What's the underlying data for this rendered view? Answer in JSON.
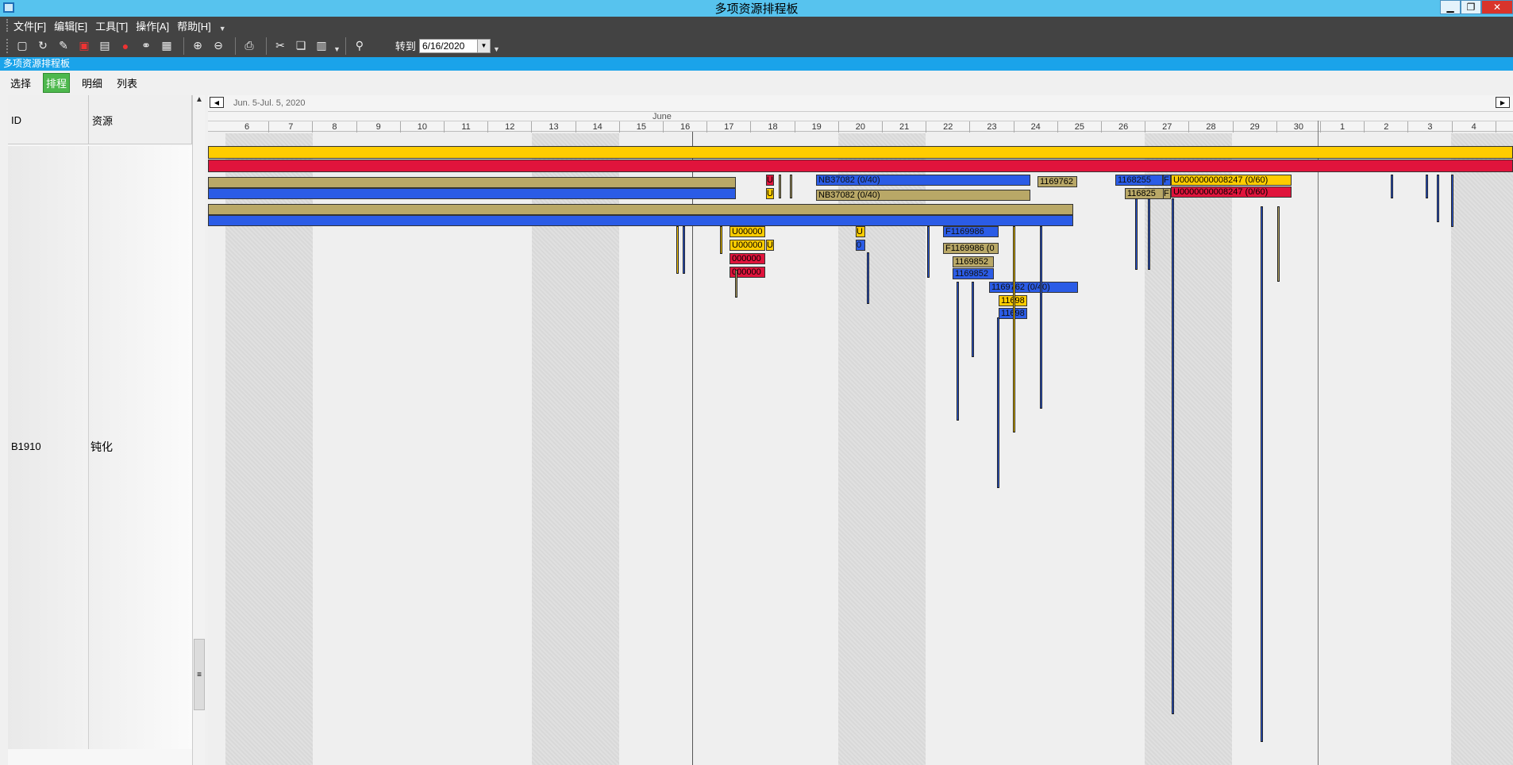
{
  "window": {
    "title": "多项资源排程板",
    "minimize": "▁",
    "restore": "❐",
    "close": "✕"
  },
  "menu": [
    "文件[F]",
    "编辑[E]",
    "工具[T]",
    "操作[A]",
    "帮助[H]"
  ],
  "toolbar": {
    "icons": [
      "new-icon",
      "refresh-icon",
      "clear-icon",
      "save-icon",
      "clipboard-icon",
      "record-icon",
      "link-icon",
      "calendar-icon",
      "zoom-in-icon",
      "zoom-out-icon",
      "print-icon",
      "cut-icon",
      "copy-icon",
      "paste-icon",
      "binoculars-icon"
    ],
    "goto_label": "转到",
    "goto_date": "6/16/2020"
  },
  "subtitle": "多项资源排程板",
  "tabs": [
    {
      "label": "选择",
      "active": false
    },
    {
      "label": "排程",
      "active": true
    },
    {
      "label": "明细",
      "active": false
    },
    {
      "label": "列表",
      "active": false
    }
  ],
  "left_pane": {
    "col_id": "ID",
    "col_resource": "资源",
    "row": {
      "id": "B1910",
      "resource": "钝化"
    }
  },
  "gantt": {
    "range": "Jun. 5-Jul. 5, 2020",
    "month": "June",
    "days": [
      "6",
      "7",
      "8",
      "9",
      "10",
      "11",
      "12",
      "13",
      "14",
      "15",
      "16",
      "17",
      "18",
      "19",
      "20",
      "21",
      "22",
      "23",
      "24",
      "25",
      "26",
      "27",
      "28",
      "29",
      "30",
      "1",
      "2",
      "3",
      "4"
    ],
    "bar_labels": {
      "nb1": "NB37082 (0/40)",
      "nb2": "NB37082 (0/40)",
      "b1169762": "1169762",
      "b1168255": "1168255",
      "b116825": "116825",
      "f1": "F",
      "f2": "F",
      "u_yellow": "U0000000008247 (0/60)",
      "u_red": "U0000000008247 (0/60)",
      "u00_1": "U00000",
      "u00_2": "U00000",
      "u00_3": "000000",
      "u00_4": "000000",
      "f1169986": "F1169986",
      "f1169986b": "F1169986 (0",
      "b1169852a": "1169852",
      "b1169852b": "1169852",
      "b1169762b": "1169762 (0/40)",
      "b11698a": "11698",
      "b11698b": "11698",
      "u_small1": "U",
      "u_small2": "U",
      "u_small3": "U",
      "u_small4": "U",
      "u_small5": "0",
      "u_small6": "U"
    },
    "colors": {
      "yellow": "#ffcc00",
      "red": "#e0143c",
      "olive": "#b9a867",
      "blue": "#2b5ce6"
    }
  }
}
